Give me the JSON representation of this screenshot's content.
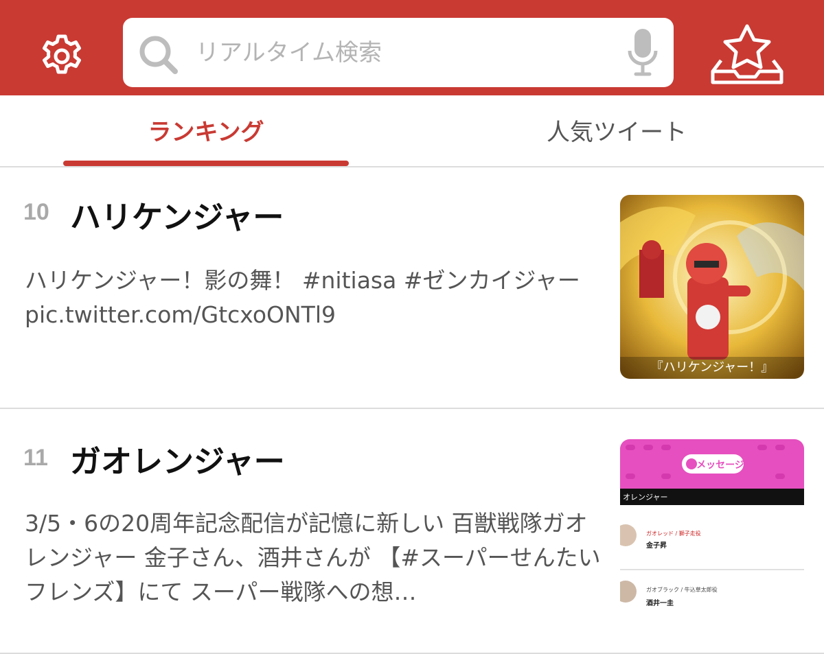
{
  "colors": {
    "accent": "#c93a33",
    "background": "#ffffff",
    "muted_text": "#555555",
    "rank_number": "#a9a9a9"
  },
  "header": {
    "settings_icon": "gear-icon",
    "search": {
      "placeholder": "リアルタイム検索",
      "value": "",
      "search_icon": "search-icon",
      "mic_icon": "microphone-icon"
    },
    "favorites_icon": "star-tray-icon"
  },
  "tabs": [
    {
      "label": "ランキング",
      "active": true
    },
    {
      "label": "人気ツイート",
      "active": false
    }
  ],
  "ranking": [
    {
      "rank": "10",
      "title": "ハリケンジャー",
      "text": "ハリケンジャー！影の舞！ #nitiasa #ゼンカイジャー pic.twitter.com/GtcxoONTl9",
      "thumbnail": {
        "caption": "『ハリケンジャー！』"
      }
    },
    {
      "rank": "11",
      "title": "ガオレンジャー",
      "text": "3/5・6の20周年記念配信が記憶に新しい 百獣戦隊ガオレンジャー 金子さん、酒井さんが 【#スーパーせんたいフレンズ】にて スーパー戦隊への想…",
      "thumbnail": {
        "header_label": "メッセージ",
        "section_label": "オレンジャー",
        "people": [
          {
            "role": "ガオレッド / 獅子走役",
            "name": "金子昇"
          },
          {
            "role": "ガオブラック / 牛込草太郎役",
            "name": "酒井一圭"
          }
        ]
      }
    }
  ]
}
